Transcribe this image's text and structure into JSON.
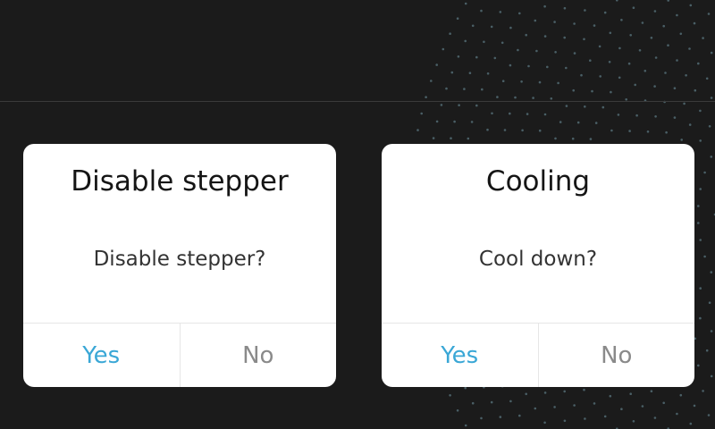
{
  "theme": {
    "background": "#1b1b1b",
    "dialog_background": "#ffffff",
    "accent": "#3aa7d6",
    "muted": "#8a8a8a",
    "dot_color": "#4a5f66"
  },
  "dialogs": [
    {
      "title": "Disable stepper",
      "message": "Disable stepper?",
      "confirm_label": "Yes",
      "cancel_label": "No"
    },
    {
      "title": "Cooling",
      "message": "Cool down?",
      "confirm_label": "Yes",
      "cancel_label": "No"
    }
  ]
}
